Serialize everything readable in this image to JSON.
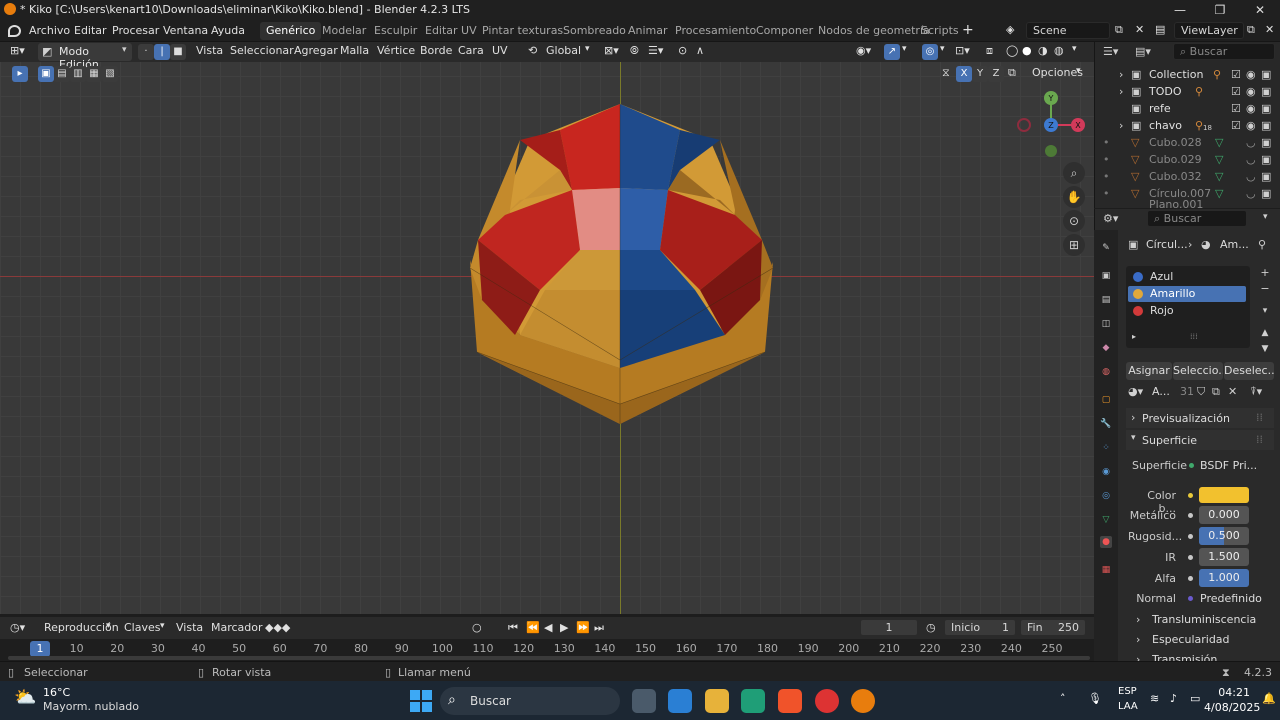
{
  "window": {
    "title": "* Kiko [C:\\Users\\kenart10\\Downloads\\eliminar\\Kiko\\Kiko.blend] - Blender 4.2.3 LTS",
    "minimize": "—",
    "maximize": "❐",
    "close": "✕"
  },
  "menu": {
    "archivo": "Archivo",
    "editar": "Editar",
    "procesar": "Procesar",
    "ventana": "Ventana",
    "ayuda": "Ayuda"
  },
  "workspaces": [
    "Genérico",
    "Modelar",
    "Esculpir",
    "Editar UV",
    "Pintar texturas",
    "Sombreado",
    "Animar",
    "Procesamiento",
    "Componer",
    "Nodos de geometría",
    "Scripts"
  ],
  "scene": {
    "name": "Scene",
    "view_layer": "ViewLayer"
  },
  "viewport_header": {
    "mode": "Modo Edición",
    "vista": "Vista",
    "seleccionar": "Seleccionar",
    "agregar": "Agregar",
    "malla": "Malla",
    "vertice": "Vértice",
    "borde": "Borde",
    "cara": "Cara",
    "uv": "UV",
    "transform": "Global",
    "opciones": "Opciones",
    "x": "X",
    "y": "Y",
    "z": "Z"
  },
  "gizmo": {
    "y": "Y",
    "z": "Z",
    "x": "X"
  },
  "outliner": {
    "search_placeholder": "Buscar",
    "items": [
      {
        "label": "Collection",
        "dim": false
      },
      {
        "label": "TODO",
        "dim": false
      },
      {
        "label": "refe",
        "dim": false
      },
      {
        "label": "chavo",
        "dim": false,
        "badge": "18"
      },
      {
        "label": "Cubo.028",
        "dim": true
      },
      {
        "label": "Cubo.029",
        "dim": true
      },
      {
        "label": "Cubo.032",
        "dim": true
      },
      {
        "label": "Círculo.007",
        "dim": true
      },
      {
        "label": "Plano.001",
        "dim": true
      }
    ]
  },
  "properties": {
    "search_placeholder": "Buscar",
    "breadcrumb_object": "Círcul...",
    "breadcrumb_material": "Am...",
    "materials": [
      {
        "name": "Azul",
        "color": "#3a6cc7",
        "selected": false
      },
      {
        "name": "Amarillo",
        "color": "#e0a83a",
        "selected": true
      },
      {
        "name": "Rojo",
        "color": "#d23a3a",
        "selected": false
      }
    ],
    "assign": "Asignar",
    "select": "Seleccio...",
    "deselect": "Deselec...",
    "material_slot_name": "A...",
    "users": "31",
    "preview": "Previsualización",
    "surface_section": "Superficie",
    "surface_label": "Superficie",
    "surface_value": "BSDF Pri...",
    "base_color_label": "Color b...",
    "base_color": "#f2c12e",
    "metallic_label": "Metálico",
    "metallic_value": "0.000",
    "roughness_label": "Rugosid...",
    "roughness_value": "0.500",
    "roughness_fraction": 0.5,
    "ior_label": "IR",
    "ior_value": "1.500",
    "alpha_label": "Alfa",
    "alpha_value": "1.000",
    "alpha_fraction": 1.0,
    "normal_label": "Normal",
    "normal_value": "Predefinido",
    "translucency": "Transluminiscencia",
    "specular": "Especularidad",
    "transmission": "Transmisión"
  },
  "timeline": {
    "playback": "Reproducción",
    "keys": "Claves",
    "view": "Vista",
    "marker": "Marcador",
    "current_frame": "1",
    "start_label": "Inicio",
    "start": "1",
    "end_label": "Fin",
    "end": "250",
    "ruler": [
      "1",
      "10",
      "20",
      "30",
      "40",
      "50",
      "60",
      "70",
      "80",
      "90",
      "100",
      "110",
      "120",
      "130",
      "140",
      "150",
      "160",
      "170",
      "180",
      "190",
      "200",
      "210",
      "220",
      "230",
      "240",
      "250"
    ]
  },
  "statusbar": {
    "select": "Seleccionar",
    "rotate": "Rotar vista",
    "menu": "Llamar menú",
    "version": "4.2.3"
  },
  "taskbar": {
    "temperature": "16°C",
    "weather": "Mayorm. nublado",
    "search": "Buscar",
    "lang": "ESP",
    "layout": "LAA",
    "time": "04:21",
    "date": "4/08/2025"
  },
  "colors": {
    "yellow_face": "#d9a23a",
    "red_face": "#c62a24",
    "blue_face": "#1d4a8a",
    "accent": "#4772b3"
  }
}
